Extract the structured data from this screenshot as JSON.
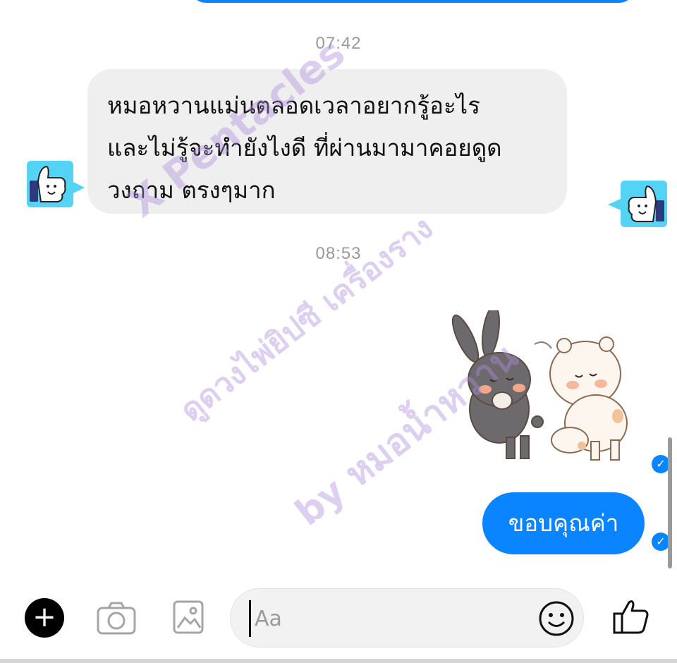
{
  "conversation": {
    "timestamp_1": "07:42",
    "timestamp_2": "08:53",
    "received_message": {
      "lines": [
        "หมอหวานแม่นตลอดเวลาอยากรู้อะไร",
        "และไม่รู้จะทำยังไงดี ที่ผ่านมามาคอยดูด",
        "วงถาม ตรงๆมาก"
      ]
    },
    "sent_message": "ขอบคุณค่า"
  },
  "watermark": {
    "line_1": "X Pentacles",
    "line_2": "ดูดวงไพ่ยิปซี เครื่องราง",
    "line_3": "by หมอน้ำหวาน"
  },
  "composer": {
    "placeholder": "Aa"
  },
  "colors": {
    "accent": "#0a84ff",
    "received_bubble": "#efefef",
    "avatar_bg": "#55d3f5"
  },
  "icons": {
    "add": "plus-icon",
    "camera": "camera-icon",
    "gallery": "image-icon",
    "emoji": "smiley-icon",
    "like": "thumbs-up-icon",
    "read": "check-icon"
  }
}
